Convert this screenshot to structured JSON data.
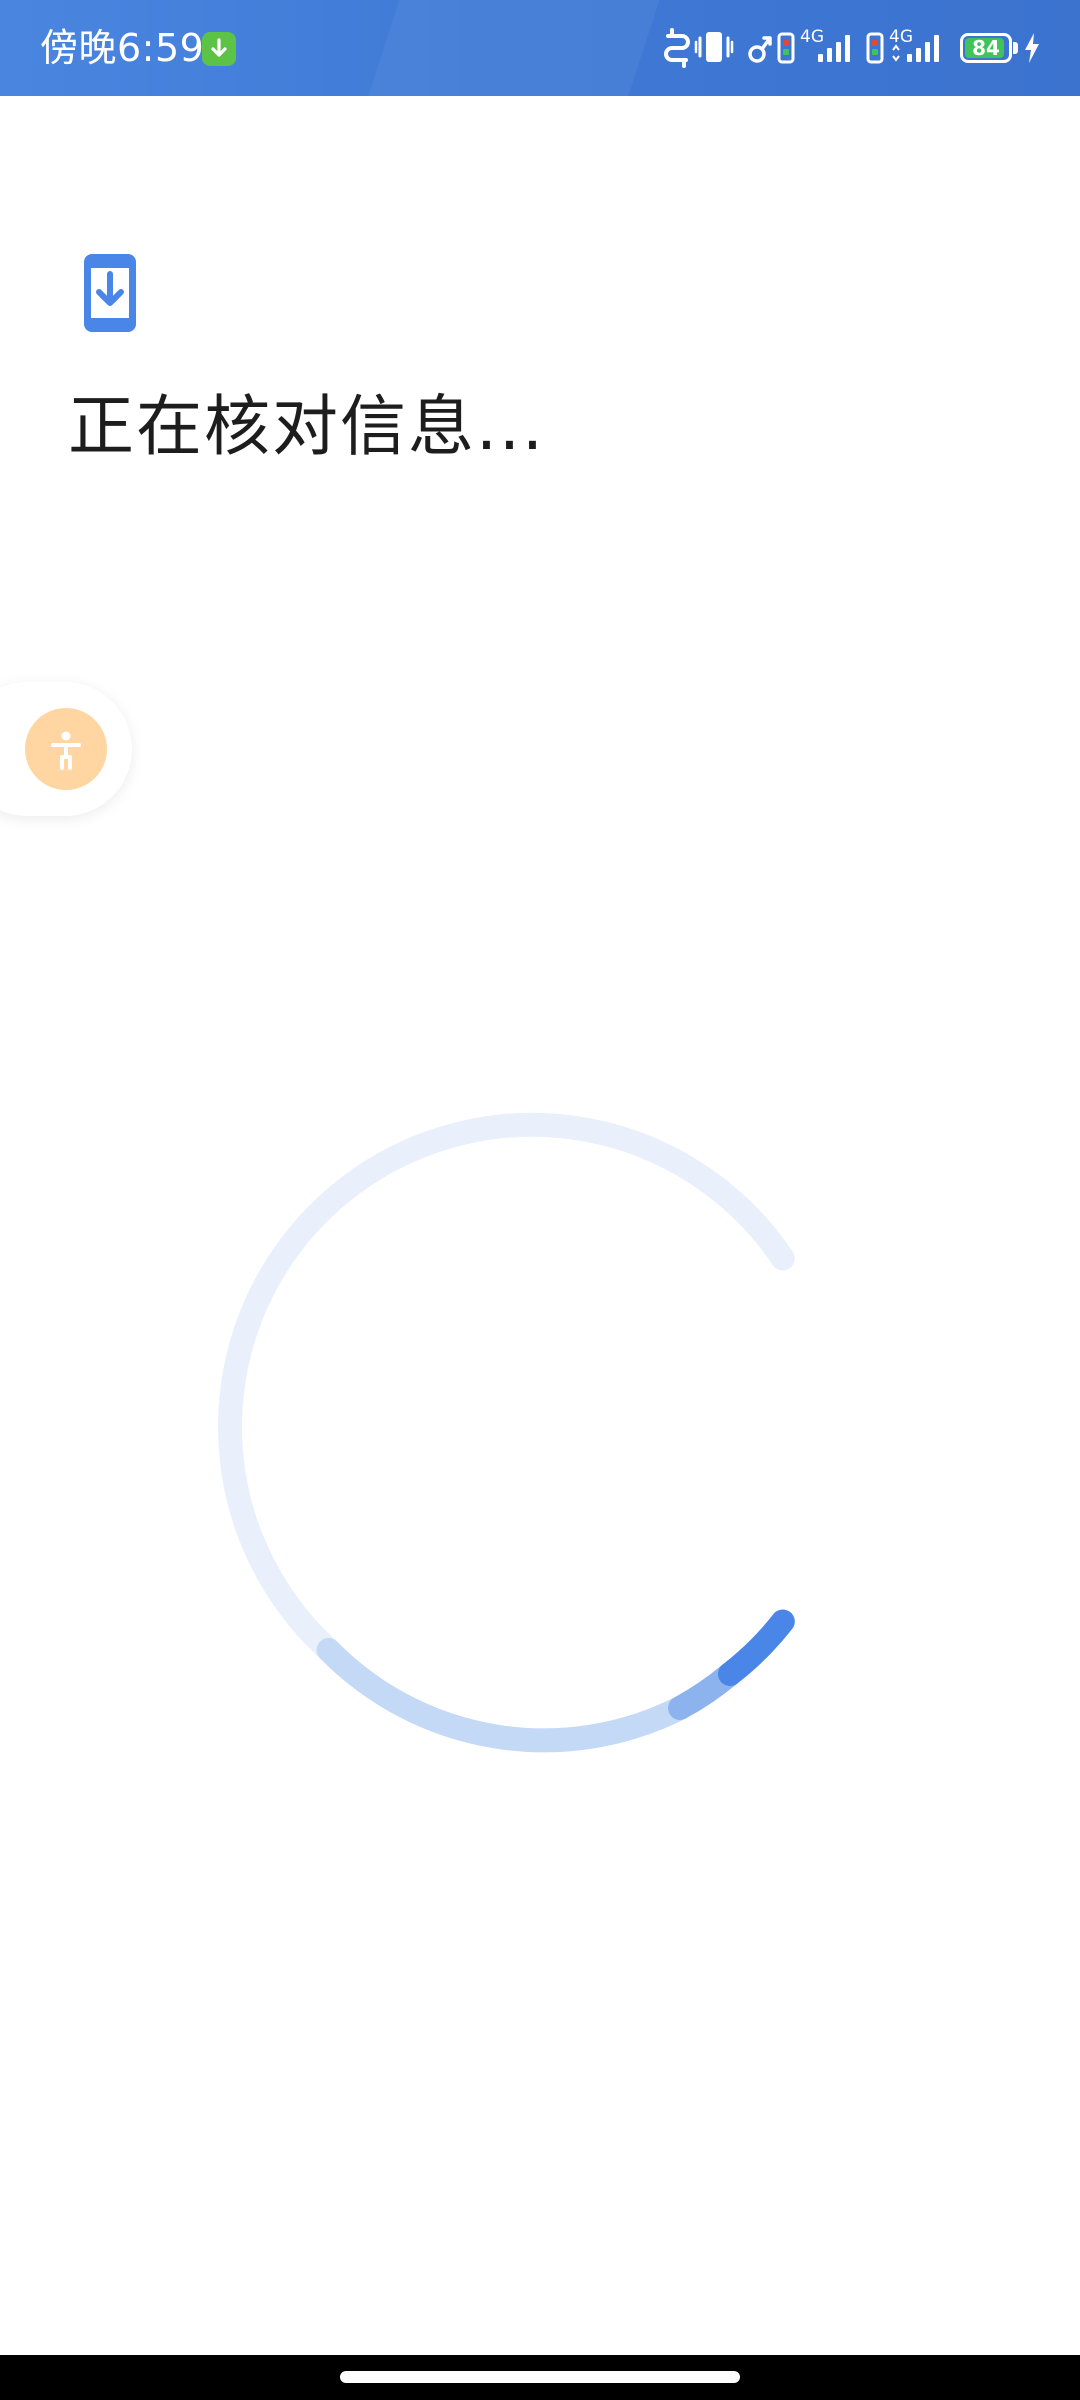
{
  "status_bar": {
    "time": "傍晚6:59",
    "network_1": "4G",
    "network_2": "4G",
    "battery_level": "84",
    "colors": {
      "background": "#3f7ad6",
      "download_badge": "#5cc346",
      "battery_fill": "#3fc35a"
    },
    "icons": [
      "download-icon",
      "nfc-icon",
      "vibrate-icon",
      "bluetooth-headset-icon",
      "sim-card-icon",
      "signal-icon",
      "battery-icon",
      "charging-icon"
    ]
  },
  "main": {
    "title": "正在核对信息...",
    "header_icon": "phone-download-icon",
    "accent_color": "#4a86e8"
  },
  "accessibility": {
    "icon": "accessibility-icon",
    "color": "#ffd5a2"
  },
  "spinner": {
    "track_color": "#e9f0fc",
    "progress_color": "#4a86e8"
  }
}
